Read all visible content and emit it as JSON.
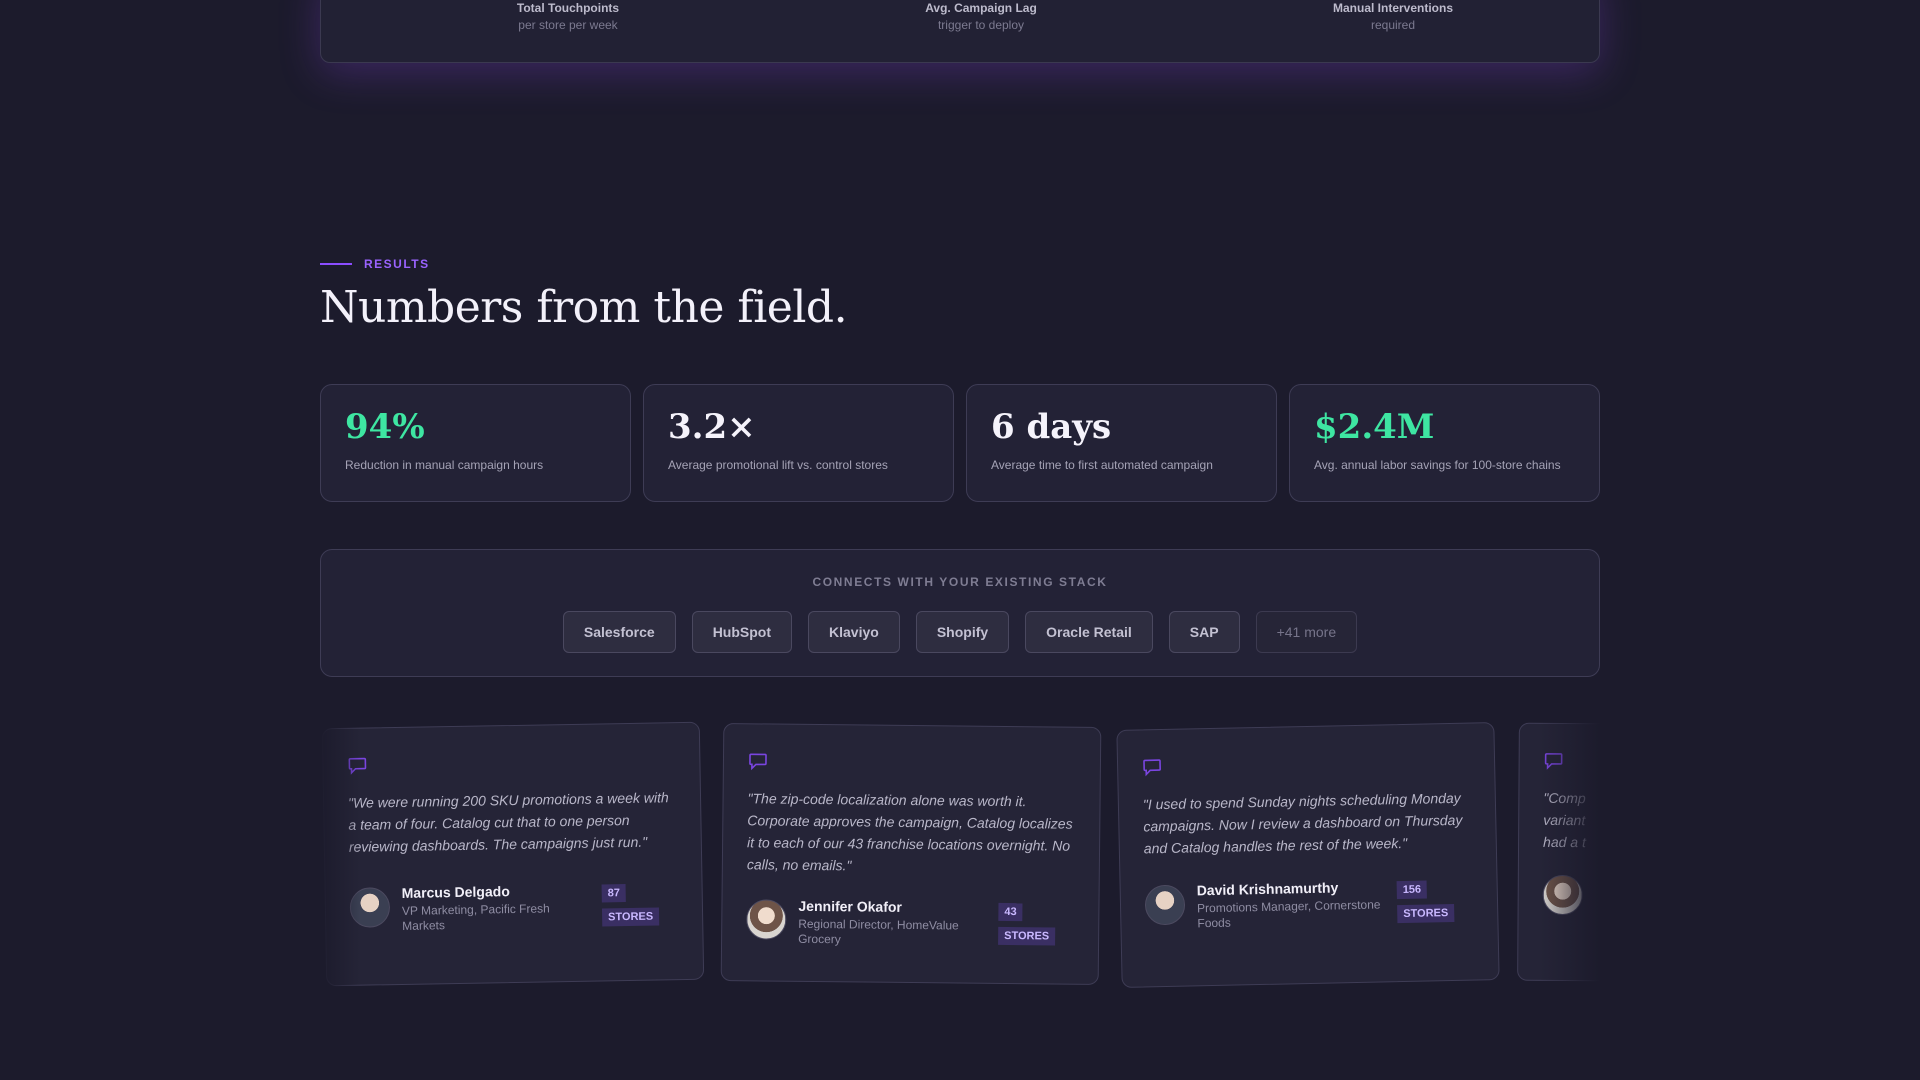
{
  "top_metrics": [
    {
      "title": "Total Touchpoints",
      "sub": "per store per week"
    },
    {
      "title": "Avg. Campaign Lag",
      "sub": "trigger to deploy"
    },
    {
      "title": "Manual Interventions",
      "sub": "required"
    }
  ],
  "results": {
    "eyebrow": "RESULTS",
    "headline": "Numbers from the field."
  },
  "stats": [
    {
      "value": "94%",
      "desc": "Reduction in manual campaign hours",
      "color": "#3ee6a2"
    },
    {
      "value": "3.2×",
      "desc": "Average promotional lift vs. control stores",
      "color": "#f5f3fb"
    },
    {
      "value": "6 days",
      "desc": "Average time to first automated campaign",
      "color": "#f5f3fb"
    },
    {
      "value": "$2.4M",
      "desc": "Avg. annual labor savings for 100-store chains",
      "color": "#3ee6a2"
    }
  ],
  "stack": {
    "title": "CONNECTS WITH YOUR EXISTING STACK",
    "integrations": [
      "Salesforce",
      "HubSpot",
      "Klaviyo",
      "Shopify",
      "Oracle Retail",
      "SAP"
    ],
    "more": "+41 more"
  },
  "testimonials": [
    {
      "quote": "\"We were running 200 SKU promotions a week with a team of four. Catalog cut that to one person reviewing dashboards. The campaigns just run.\"",
      "name": "Marcus Delgado",
      "role": "VP Marketing, Pacific Fresh Markets",
      "badge_num": "87",
      "badge_unit": "STORES"
    },
    {
      "quote": "\"The zip-code localization alone was worth it. Corporate approves the campaign, Catalog localizes it to each of our 43 franchise locations overnight. No calls, no emails.\"",
      "name": "Jennifer Okafor",
      "role": "Regional Director, HomeValue Grocery",
      "badge_num": "43",
      "badge_unit": "STORES"
    },
    {
      "quote": "\"I used to spend Sunday nights scheduling Monday campaigns. Now I review a dashboard on Thursday and Catalog handles the rest of the week.\"",
      "name": "David Krishnamurthy",
      "role": "Promotions Manager, Cornerstone Foods",
      "badge_num": "156",
      "badge_unit": "STORES"
    },
    {
      "quote": "\"Comp variant had a t",
      "name": "",
      "role": "",
      "badge_num": "",
      "badge_unit": ""
    }
  ],
  "colors": {
    "background": "#1c1b2c",
    "accent": "#8b4dff",
    "positive": "#3ee6a2"
  }
}
